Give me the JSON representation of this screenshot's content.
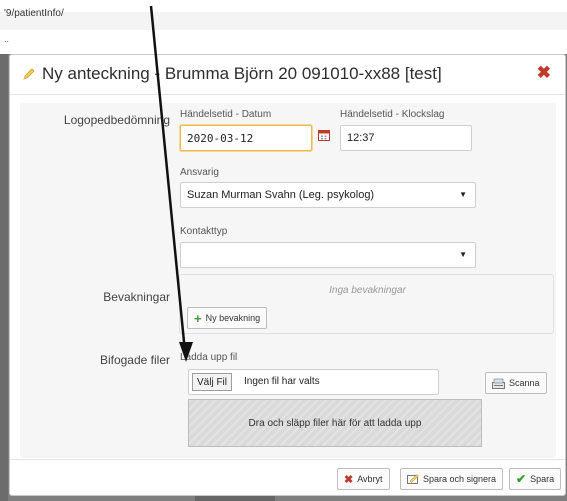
{
  "browser": {
    "url": "'9/patientInfo/",
    "subtext": ".."
  },
  "modal": {
    "title": "Ny anteckning - Brumma Björn 20 091010-xx88 [test]",
    "close_glyph": "✖",
    "header_icon": "pencil-icon"
  },
  "form": {
    "section_label": "Logopedbedömning",
    "date": {
      "label": "Händelsetid - Datum",
      "value": "2020-03-12",
      "icon": "calendar-icon"
    },
    "time": {
      "label": "Händelsetid - Klockslag",
      "value": "12:37"
    },
    "responsible": {
      "label": "Ansvarig",
      "value": "Suzan Murman Svahn (Leg. psykolog)"
    },
    "contact_type": {
      "label": "Kontakttyp",
      "value": ""
    },
    "surveillance": {
      "label": "Bevakningar",
      "empty_text": "Inga bevakningar",
      "add_button": "Ny bevakning"
    },
    "attachments": {
      "label": "Bifogade filer",
      "upload_label": "Ladda upp fil",
      "choose_button": "Välj Fil",
      "no_file_text": "Ingen fil har valts",
      "scan_button": "Scanna",
      "dropzone_text": "Dra och släpp filer här för att ladda upp"
    }
  },
  "footer": {
    "cancel": "Avbryt",
    "save_sign": "Spara och signera",
    "save": "Spara"
  },
  "colors": {
    "accent_focus": "#f0b84a",
    "close": "#c0392b",
    "save_check": "#3a9d2f"
  }
}
